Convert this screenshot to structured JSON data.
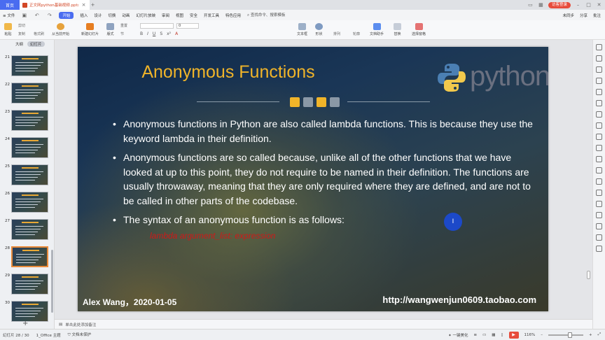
{
  "titlebar": {
    "home_tab": "首页",
    "doc_tab": "正文网python基础视频.pptx",
    "login": "访客登录"
  },
  "menubar": {
    "file": "≡ 文件",
    "items": [
      "开始",
      "插入",
      "设计",
      "切换",
      "动画",
      "幻灯片放映",
      "审阅",
      "视图",
      "安全",
      "开发工具",
      "特色应用"
    ],
    "active": "开始",
    "search": "查找命令、搜索模板",
    "right": [
      "未同步",
      "分享",
      "批注"
    ]
  },
  "ribbon": {
    "paste": "粘贴",
    "cut": "剪切",
    "copy": "复制",
    "format_painter": "格式刷",
    "from_current": "从当前开始",
    "new_slide": "新建幻灯片",
    "layout": "版式",
    "section": "节",
    "reset": "重置",
    "font_size": "0",
    "textbox": "文本框",
    "shape": "形状",
    "arrange": "排列",
    "outline": "轮廓",
    "text_tools": "文档助手",
    "replace": "替换",
    "select_pane": "选择窗格"
  },
  "leftpanel": {
    "tab_outline": "大纲",
    "tab_slides": "幻灯片",
    "slides": [
      {
        "num": "21"
      },
      {
        "num": "22"
      },
      {
        "num": "23"
      },
      {
        "num": "24"
      },
      {
        "num": "25"
      },
      {
        "num": "26"
      },
      {
        "num": "27"
      },
      {
        "num": "28"
      },
      {
        "num": "29"
      },
      {
        "num": "30"
      }
    ],
    "selected": "28",
    "add": "+"
  },
  "slide": {
    "title": "Anonymous Functions",
    "python_word": "python",
    "bullets": [
      "Anonymous functions in Python are also called lambda functions. This is because they use the keyword lambda in their definition.",
      "Anonymous functions are so called because, unlike all of the other functions that we have looked at up to this point, they do not require to be named in their definition. The functions are usually throwaway, meaning that they are only required where they are defined, and are not to be called in other parts of the codebase.",
      "The syntax of an anonymous function is as follows:"
    ],
    "code": "lambda argument_list: expression",
    "author": "Alex Wang，2020-01-05",
    "url": "http://wangwenjun0609.taobao.com",
    "cursor_label": "I",
    "colors": {
      "title": "#f0b429",
      "code": "#d01818"
    }
  },
  "notes": {
    "placeholder": "单击此处添加备注"
  },
  "statusbar": {
    "slide_pos": "幻灯片 28 / 30",
    "theme": "1_Office 主题",
    "protect": "文档未保护",
    "beautify": "一键美化",
    "zoom": "116%"
  }
}
